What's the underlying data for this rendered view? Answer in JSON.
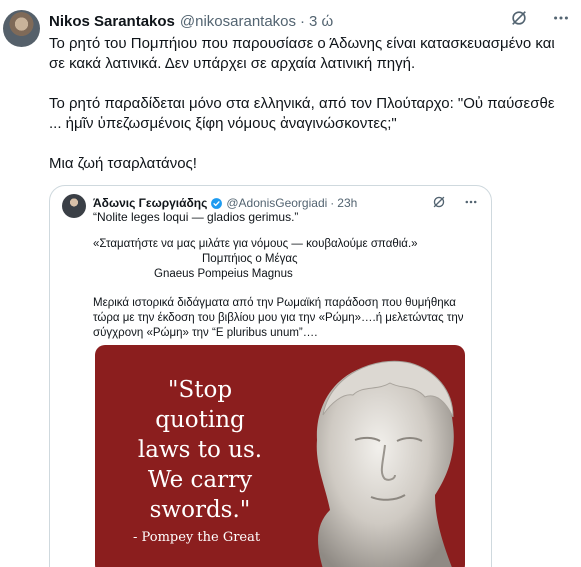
{
  "tweet": {
    "author_name": "Nikos Sarantakos",
    "author_handle": "@nikosarantakos",
    "separator": "·",
    "time": "3 ώ",
    "paragraphs": [
      "Το ρητό του Πομπήιου που παρουσίασε ο Άδωνης είναι κατασκευασμένο και σε κακά λατινικά. Δεν υπάρχει σε αρχαία λατινική πηγή.",
      "Το ρητό παραδίδεται μόνο στα ελληνικά, από τον Πλούταρχο: \"Οὐ παύσεσθε ... ἡμῖν ὑπεζωσμένοις ξίφη νόμους ἀναγινώσκοντες;\"",
      "Μια ζωή τσαρλατάνος!"
    ]
  },
  "quoted_tweet": {
    "author_name": "Άδωνις Γεωργιάδης",
    "author_handle": "@AdonisGeorgiadi",
    "separator": "·",
    "time": "23h",
    "first_line": "“Nolite leges loqui — gladios gerimus.”",
    "greek_quote": "«Σταματήστε να μας μιλάτε για νόμους — κουβαλούμε σπαθιά.»",
    "attribution_greek": "Πομπήιος ο Μέγας",
    "attribution_latin": "Gnaeus Pompeius Magnus",
    "body_lines": [
      "Μερικά ιστορικά διδάγματα από την Ρωμαϊκή παράδοση που θυμήθηκα",
      "τώρα με την έκδοση του βιβλίου μου για την «Ρώμη»….ή μελετώντας την",
      "σύγχρονη «Ρώμη» την “E pluribus unum”…."
    ],
    "image": {
      "quote_lines": [
        "\"Stop",
        "quoting",
        "laws to us.",
        "We carry",
        "swords.\""
      ],
      "attribution": "- Pompey the Great",
      "background": "#8b1e1e"
    }
  },
  "icons": {
    "grok": "grok-icon",
    "more": "more-icon",
    "verified": "verified-badge-icon"
  },
  "colors": {
    "text": "#0f1419",
    "secondary": "#536471",
    "border": "#cfd9de",
    "verified": "#1d9bf0"
  }
}
